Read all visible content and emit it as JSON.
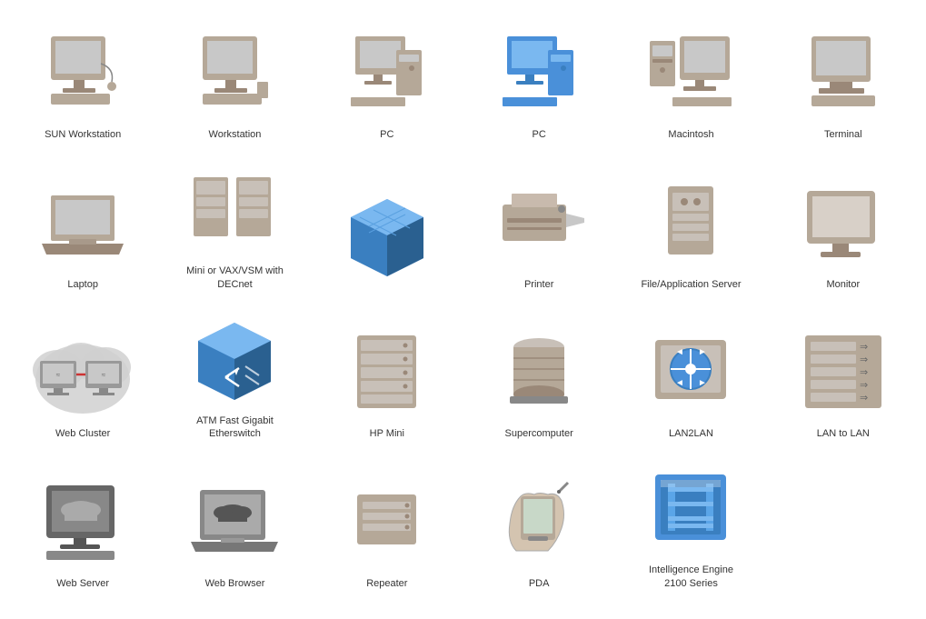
{
  "items": [
    {
      "id": "sun-workstation",
      "label": "SUN Workstation"
    },
    {
      "id": "workstation",
      "label": "Workstation"
    },
    {
      "id": "pc-gray",
      "label": "PC"
    },
    {
      "id": "pc-blue",
      "label": "PC"
    },
    {
      "id": "macintosh",
      "label": "Macintosh"
    },
    {
      "id": "terminal",
      "label": "Terminal"
    },
    {
      "id": "laptop",
      "label": "Laptop"
    },
    {
      "id": "mini-vax",
      "label": "Mini or VAX/VSM with DECnet"
    },
    {
      "id": "blue-cube",
      "label": ""
    },
    {
      "id": "printer",
      "label": "Printer"
    },
    {
      "id": "file-server",
      "label": "File/Application Server"
    },
    {
      "id": "monitor",
      "label": "Monitor"
    },
    {
      "id": "web-cluster",
      "label": "Web Cluster"
    },
    {
      "id": "atm-fast",
      "label": "ATM Fast Gigabit Etherswitch"
    },
    {
      "id": "hp-mini",
      "label": "HP Mini"
    },
    {
      "id": "supercomputer",
      "label": "Supercomputer"
    },
    {
      "id": "lan2lan",
      "label": "LAN2LAN"
    },
    {
      "id": "lan-to-lan",
      "label": "LAN to LAN"
    },
    {
      "id": "web-server",
      "label": "Web Server"
    },
    {
      "id": "web-browser",
      "label": "Web Browser"
    },
    {
      "id": "repeater",
      "label": "Repeater"
    },
    {
      "id": "pda",
      "label": "PDA"
    },
    {
      "id": "intel-engine",
      "label": "Intelligence Engine 2100 Series"
    },
    {
      "id": "empty",
      "label": ""
    }
  ]
}
